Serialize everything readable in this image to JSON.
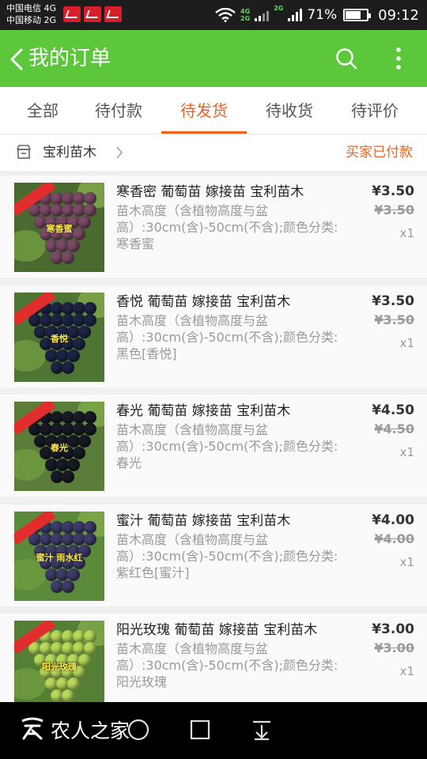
{
  "status_bar": {
    "carrier1": "中国电信 4G",
    "carrier2": "中国移动 2G",
    "net_top": "4G",
    "net_bottom": "2G",
    "net2": "2G",
    "battery": "71%",
    "battery_level": 0.71,
    "time": "09:12"
  },
  "header": {
    "title": "我的订单",
    "icons": [
      "back-icon",
      "search-icon",
      "more-icon"
    ]
  },
  "tabs": [
    {
      "label": "全部",
      "active": false
    },
    {
      "label": "待付款",
      "active": false
    },
    {
      "label": "待发货",
      "active": true
    },
    {
      "label": "待收货",
      "active": false
    },
    {
      "label": "待评价",
      "active": false
    }
  ],
  "shop": {
    "name": "宝利苗木",
    "status": "买家已付款"
  },
  "orders": [
    {
      "name": "寒香密 葡萄苗 嫁接苗 宝利苗木",
      "spec": "苗木高度（含植物高度与盆高）:30cm(含)-50cm(不含);颜色分类:寒香蜜",
      "price": "¥3.50",
      "original_price": "¥3.50",
      "qty": "x1",
      "image_label": "寒香蜜"
    },
    {
      "name": "香悦 葡萄苗 嫁接苗 宝利苗木",
      "spec": "苗木高度（含植物高度与盆高）:30cm(含)-50cm(不含);颜色分类:黑色[香悦]",
      "price": "¥3.50",
      "original_price": "¥3.50",
      "qty": "x1",
      "image_label": "香悦"
    },
    {
      "name": "春光 葡萄苗 嫁接苗 宝利苗木",
      "spec": "苗木高度（含植物高度与盆高）:30cm(含)-50cm(不含);颜色分类:春光",
      "price": "¥4.50",
      "original_price": "¥4.50",
      "qty": "x1",
      "image_label": "春光"
    },
    {
      "name": "蜜汁  葡萄苗 嫁接苗 宝利苗木",
      "spec": "苗木高度（含植物高度与盆高）:30cm(含)-50cm(不含);颜色分类:紫红色[蜜汁]",
      "price": "¥4.00",
      "original_price": "¥4.00",
      "qty": "x1",
      "image_label": "蜜汁 雨水红"
    },
    {
      "name": "阳光玫瑰 葡萄苗 嫁接苗 宝利苗木",
      "spec": "苗木高度（含植物高度与盆高）:30cm(含)-50cm(不含);颜色分类:阳光玫瑰",
      "price": "¥3.00",
      "original_price": "¥3.00",
      "qty": "x1",
      "image_label": "阳光玫瑰"
    }
  ],
  "watermark": "农人之家",
  "nav": [
    "back-triangle-icon",
    "home-circle-icon",
    "recents-square-icon",
    "notification-pull-icon"
  ],
  "colors": {
    "accent_green": "#5dc73c",
    "accent_orange": "#f0621e"
  }
}
